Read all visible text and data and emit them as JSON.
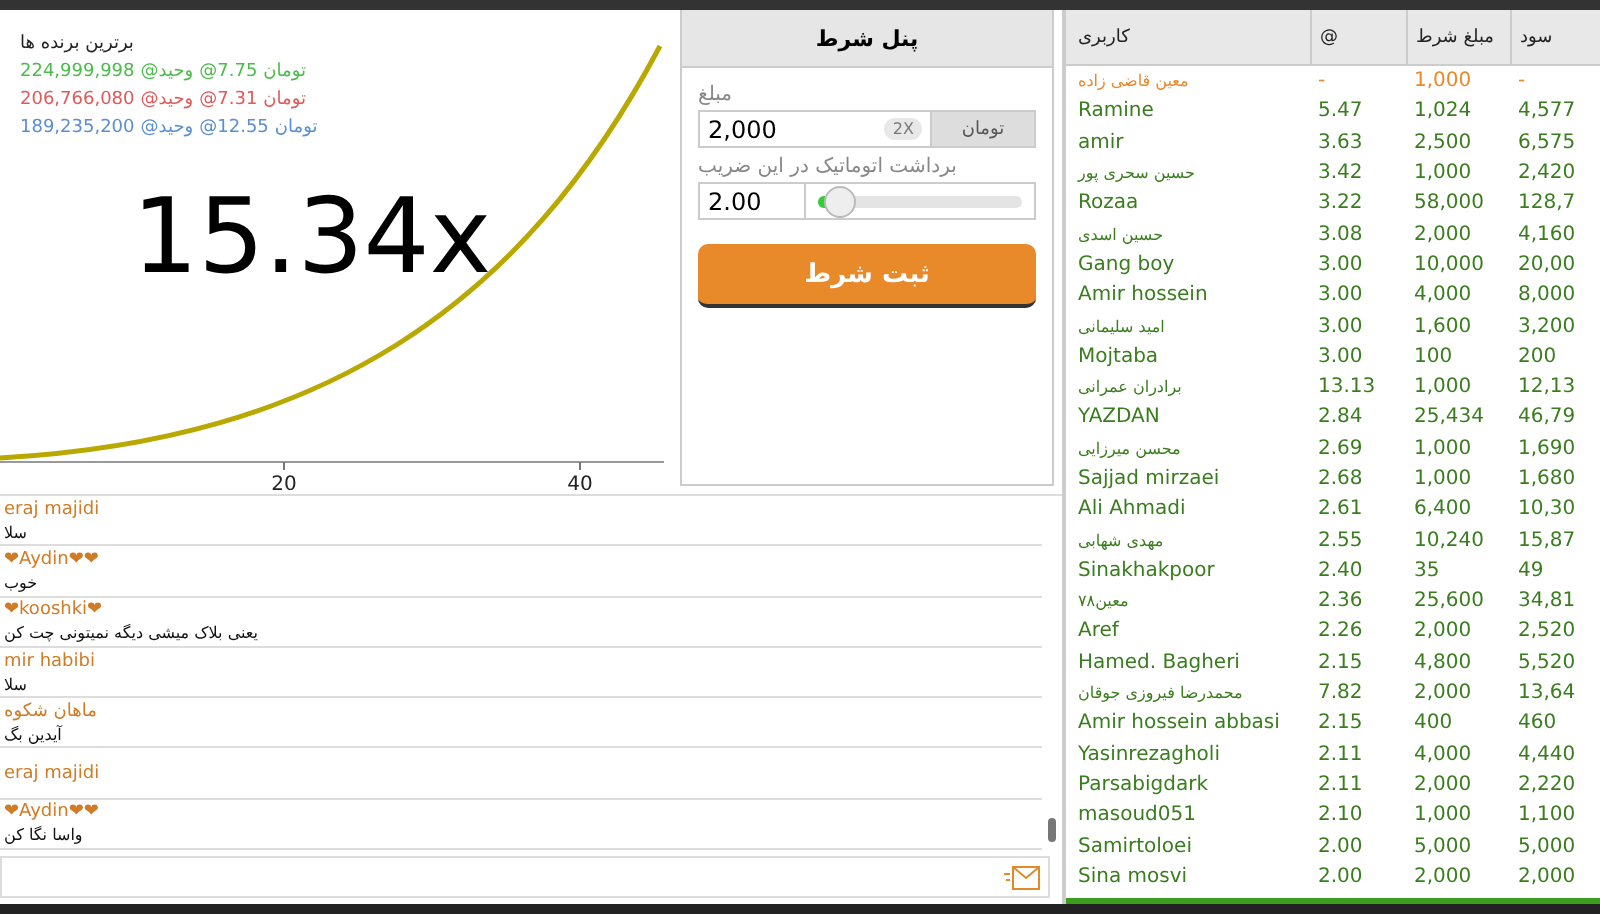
{
  "top_winners": {
    "title": "برترین برنده ها",
    "rows": [
      {
        "amount": "224,999,998",
        "user": "@وحید",
        "multiplier": "@7.75",
        "unit": "تومان",
        "color": "#4cbb4c"
      },
      {
        "amount": "206,766,080",
        "user": "@وحید",
        "multiplier": "@7.31",
        "unit": "تومان",
        "color": "#e05a5a"
      },
      {
        "amount": "189,235,200",
        "user": "@وحید",
        "multiplier": "@12.55",
        "unit": "تومان",
        "color": "#5b8fd0"
      }
    ]
  },
  "game": {
    "multiplier": "15.34x",
    "axis_ticks": [
      "20",
      "40"
    ]
  },
  "bet_panel": {
    "title": "پنل شرط",
    "amount_label": "مبلغ",
    "amount": "2,000",
    "double_label": "2X",
    "currency": "تومان",
    "auto_label": "برداشت اتوماتیک در این ضریب",
    "auto_value": "2.00",
    "level": 0.08,
    "submit": "ثبت شرط"
  },
  "chat": {
    "messages": [
      {
        "user": "eraj majidi",
        "text": "سلا"
      },
      {
        "user": "❤Aydin❤❤",
        "text": "خوب"
      },
      {
        "user": "❤kooshki❤",
        "text": "یعنی بلاک میشی دیگه نمیتونی چت کن"
      },
      {
        "user": "mir habibi",
        "text": "سلا"
      },
      {
        "user": "ماهان شکوه",
        "text": "آیدین بگ"
      },
      {
        "user": "eraj majidi"
      },
      {
        "user": "❤Aydin❤❤",
        "text": "واسا نگا کن"
      }
    ]
  },
  "bets_table": {
    "columns": [
      "سود",
      "مبلغ شرط",
      "@",
      "کاربری"
    ],
    "rows": [
      {
        "user": "معین قاضی زاده",
        "multiplier": "-",
        "bet": "1,000",
        "profit": "-",
        "cashed_out": false
      },
      {
        "user": "Ramine",
        "multiplier": "5.47",
        "bet": "1,024",
        "profit": "4,577",
        "cashed_out": true
      },
      {
        "user": "amir",
        "multiplier": "3.63",
        "bet": "2,500",
        "profit": "6,575",
        "cashed_out": true
      },
      {
        "user": "حسین سحری پور",
        "multiplier": "3.42",
        "bet": "1,000",
        "profit": "2,420",
        "cashed_out": true
      },
      {
        "user": "Rozaa",
        "multiplier": "3.22",
        "bet": "58,000",
        "profit": "128,7",
        "cashed_out": true
      },
      {
        "user": "حسین اسدی",
        "multiplier": "3.08",
        "bet": "2,000",
        "profit": "4,160",
        "cashed_out": true
      },
      {
        "user": "Gang boy",
        "multiplier": "3.00",
        "bet": "10,000",
        "profit": "20,00",
        "cashed_out": true
      },
      {
        "user": "Amir hossein",
        "multiplier": "3.00",
        "bet": "4,000",
        "profit": "8,000",
        "cashed_out": true
      },
      {
        "user": "امید سلیمانی",
        "multiplier": "3.00",
        "bet": "1,600",
        "profit": "3,200",
        "cashed_out": true
      },
      {
        "user": "Mojtaba",
        "multiplier": "3.00",
        "bet": "100",
        "profit": "200",
        "cashed_out": true
      },
      {
        "user": "برادران عمرانی",
        "multiplier": "13.13",
        "bet": "1,000",
        "profit": "12,13",
        "cashed_out": true
      },
      {
        "user": "YAZDAN",
        "multiplier": "2.84",
        "bet": "25,434",
        "profit": "46,79",
        "cashed_out": true
      },
      {
        "user": "محسن میرزایی",
        "multiplier": "2.69",
        "bet": "1,000",
        "profit": "1,690",
        "cashed_out": true
      },
      {
        "user": "Sajjad mirzaei",
        "multiplier": "2.68",
        "bet": "1,000",
        "profit": "1,680",
        "cashed_out": true
      },
      {
        "user": "Ali Ahmadi",
        "multiplier": "2.61",
        "bet": "6,400",
        "profit": "10,30",
        "cashed_out": true
      },
      {
        "user": "مهدی شهابی",
        "multiplier": "2.55",
        "bet": "10,240",
        "profit": "15,87",
        "cashed_out": true
      },
      {
        "user": "Sinakhakpoor",
        "multiplier": "2.40",
        "bet": "35",
        "profit": "49",
        "cashed_out": true
      },
      {
        "user": "معین۷۸",
        "multiplier": "2.36",
        "bet": "25,600",
        "profit": "34,81",
        "cashed_out": true
      },
      {
        "user": "Aref",
        "multiplier": "2.26",
        "bet": "2,000",
        "profit": "2,520",
        "cashed_out": true
      },
      {
        "user": "Hamed. Bagheri",
        "multiplier": "2.15",
        "bet": "4,800",
        "profit": "5,520",
        "cashed_out": true
      },
      {
        "user": "محمدرضا فیروزی جوقان",
        "multiplier": "7.82",
        "bet": "2,000",
        "profit": "13,64",
        "cashed_out": true
      },
      {
        "user": "Amir hossein abbasi",
        "multiplier": "2.15",
        "bet": "400",
        "profit": "460",
        "cashed_out": true
      },
      {
        "user": "Yasinrezagholi",
        "multiplier": "2.11",
        "bet": "4,000",
        "profit": "4,440",
        "cashed_out": true
      },
      {
        "user": "Parsabigdark",
        "multiplier": "2.11",
        "bet": "2,000",
        "profit": "2,220",
        "cashed_out": true
      },
      {
        "user": "masoud051",
        "multiplier": "2.10",
        "bet": "1,000",
        "profit": "1,100",
        "cashed_out": true
      },
      {
        "user": "Samirtoloei",
        "multiplier": "2.00",
        "bet": "5,000",
        "profit": "5,000",
        "cashed_out": true
      },
      {
        "user": "Sina mosvi",
        "multiplier": "2.00",
        "bet": "2,000",
        "profit": "2,000",
        "cashed_out": true
      }
    ]
  }
}
